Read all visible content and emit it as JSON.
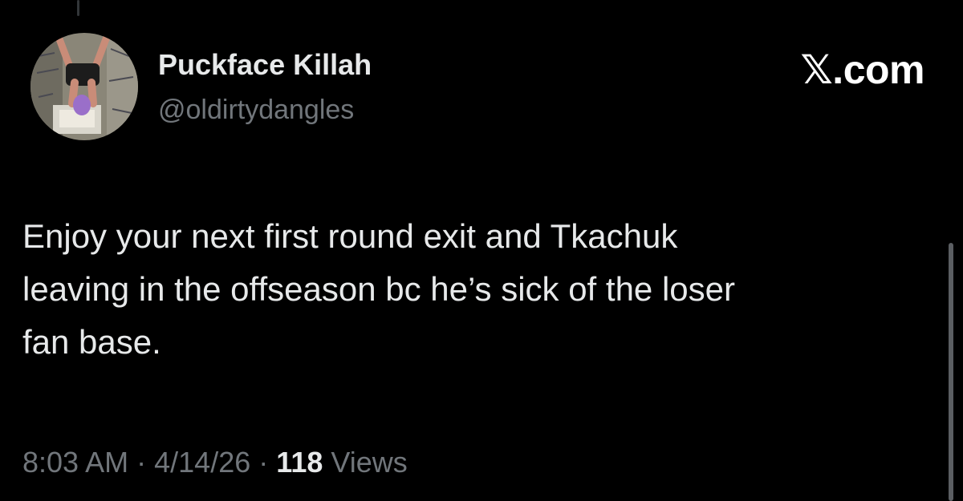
{
  "author": {
    "display_name": "Puckface Killah",
    "handle": "@oldirtydangles",
    "avatar_icon": "avatar-photo"
  },
  "source": {
    "label": "𝕏.com"
  },
  "tweet": {
    "text": "Enjoy your next first round exit and Tkachuk\nleaving in the offseason bc he’s sick of the loser\nfan base."
  },
  "meta": {
    "time": "8:03 AM",
    "separator": "·",
    "date": "4/14/26",
    "views_count": "118",
    "views_label": "Views"
  },
  "colors": {
    "background": "#000000",
    "primary_text": "#e7e9ea",
    "secondary_text": "#71767b"
  }
}
